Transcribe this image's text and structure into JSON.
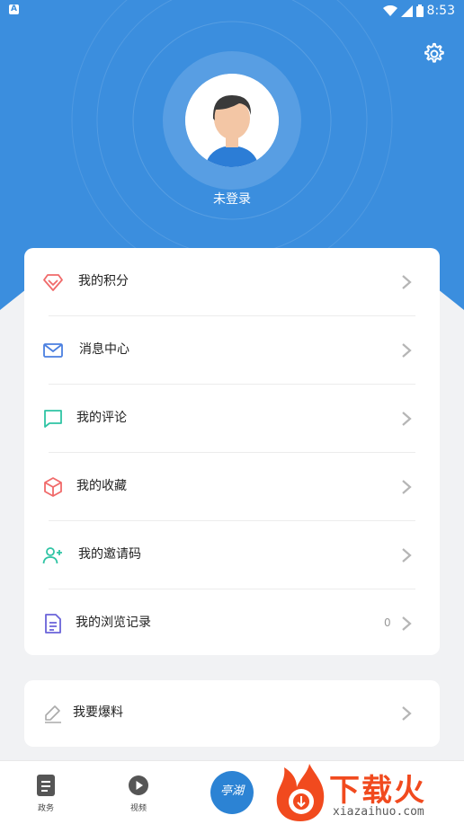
{
  "status_bar": {
    "time": "8:53",
    "app_badge": "A"
  },
  "header": {
    "login_status": "未登录"
  },
  "menu": {
    "items": [
      {
        "label": "我的积分",
        "icon": "diamond-icon",
        "color": "#f06a6a"
      },
      {
        "label": "消息中心",
        "icon": "mail-icon",
        "color": "#4a7fe0"
      },
      {
        "label": "我的评论",
        "icon": "comment-icon",
        "color": "#2fc4a4"
      },
      {
        "label": "我的收藏",
        "icon": "box-icon",
        "color": "#f06a6a"
      },
      {
        "label": "我的邀请码",
        "icon": "add-user-icon",
        "color": "#2fc4a4"
      },
      {
        "label": "我的浏览记录",
        "icon": "document-icon",
        "color": "#6a63d9",
        "count": "0"
      }
    ],
    "extra": {
      "label": "我要爆料",
      "icon": "pencil-icon",
      "color": "#aaaaaa"
    }
  },
  "tabbar": {
    "tabs": [
      {
        "label": "政务",
        "icon": "document-tab-icon"
      },
      {
        "label": "视频",
        "icon": "play-icon"
      }
    ],
    "center_logo_text": "亭湖"
  },
  "watermark": {
    "text": "下载火",
    "sub": "xiazaihuo.com"
  },
  "colors": {
    "primary": "#3b8ede",
    "background": "#f1f2f4"
  }
}
